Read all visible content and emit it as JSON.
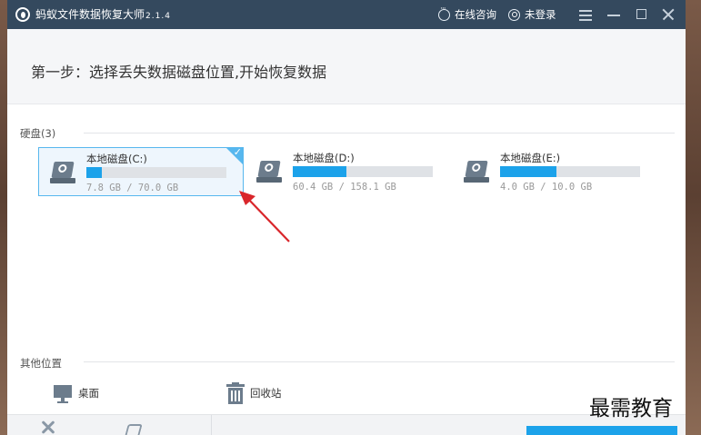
{
  "titlebar": {
    "app_title": "蚂蚁文件数据恢复大师",
    "version": "2.1.4",
    "consult_label": "在线咨询",
    "login_label": "未登录",
    "icons": [
      "app-logo-icon",
      "chat-icon",
      "user-icon",
      "menu-icon",
      "minimize-icon",
      "maximize-icon",
      "close-icon"
    ]
  },
  "step": {
    "title": "第一步：选择丢失数据磁盘位置,开始恢复数据"
  },
  "disks_section": {
    "label": "硬盘(3)",
    "drives": [
      {
        "name": "本地磁盘(C:)",
        "size": "7.8 GB / 70.0 GB",
        "used_fraction": 0.11,
        "selected": true
      },
      {
        "name": "本地磁盘(D:)",
        "size": "60.4 GB / 158.1 GB",
        "used_fraction": 0.38,
        "selected": false
      },
      {
        "name": "本地磁盘(E:)",
        "size": "4.0 GB / 10.0 GB",
        "used_fraction": 0.4,
        "selected": false
      }
    ]
  },
  "other_section": {
    "label": "其他位置",
    "items": [
      {
        "label": "桌面",
        "icon": "monitor-icon"
      },
      {
        "label": "回收站",
        "icon": "recycle-bin-icon"
      }
    ]
  },
  "watermark": "最需教育",
  "colors": {
    "titlebar": "#34495e",
    "accent": "#1ca2ea",
    "selected_border": "#57b7ee",
    "annotation_arrow": "#d9262b"
  }
}
